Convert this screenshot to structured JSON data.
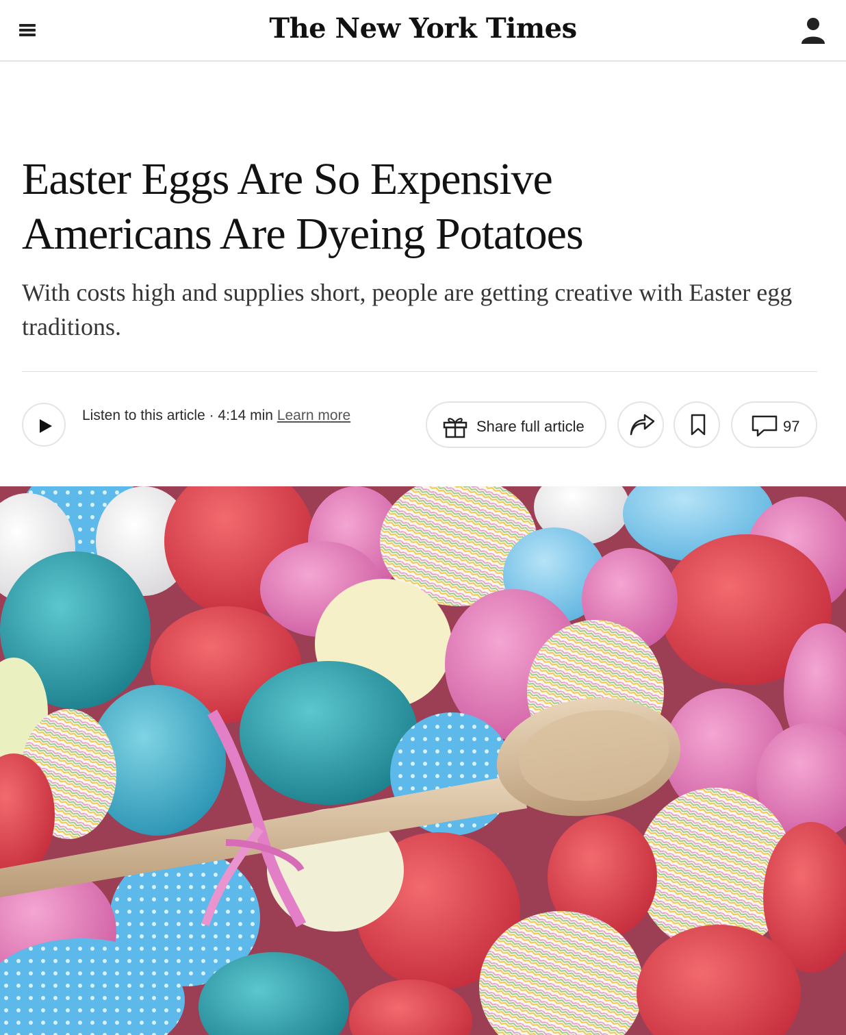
{
  "header": {
    "masthead": "The New York Times",
    "menu_icon": "hamburger-menu-icon",
    "account_icon": "account-icon"
  },
  "article": {
    "headline_line1": "Easter Eggs Are So Expensive",
    "headline_line2": "Americans Are Dyeing Potatoes",
    "summary": "With costs high and supplies short, people are getting creative with Easter egg traditions."
  },
  "toolbar": {
    "listen_label": "Listen to this article · 4:14 min",
    "learn_more_label": "Learn more",
    "share_full_label": "Share full article",
    "comments_count": "97",
    "icons": {
      "play": "play-icon",
      "gift": "gift-icon",
      "share": "share-icon",
      "bookmark": "bookmark-icon",
      "comment": "comment-icon"
    }
  },
  "media": {
    "image_alt": "Dyed and patterned Easter eggs in a basket with a wooden spoon and a pink ribbon"
  },
  "colors": {
    "text": "#121212",
    "summary": "#363636",
    "border": "#e4e4e4",
    "egg_teal": "#2fa6b3",
    "egg_red": "#e8424f",
    "egg_pink": "#e57fb8",
    "egg_blue": "#6ec3e8"
  }
}
